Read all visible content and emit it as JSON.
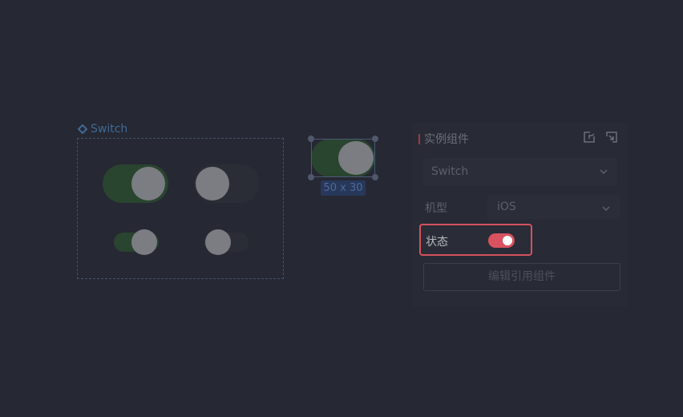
{
  "canvas": {
    "component_name": "Switch",
    "selection_size": "50 x 30",
    "variants": [
      {
        "size": "large",
        "state": "on"
      },
      {
        "size": "large",
        "state": "off"
      },
      {
        "size": "small",
        "state": "on"
      },
      {
        "size": "small",
        "state": "off"
      }
    ]
  },
  "panel": {
    "title": "实例组件",
    "component_select": {
      "value": "Switch"
    },
    "model": {
      "label": "机型",
      "value": "iOS"
    },
    "state": {
      "label": "状态",
      "on": true
    },
    "edit_button": "编辑引用组件",
    "icons": [
      "share-icon",
      "detach-icon"
    ]
  },
  "colors": {
    "background": "#262833",
    "switch_on": "#29442f",
    "accent": "#d8535f",
    "frame_border": "#3f5470",
    "label_blue": "#3f6a96"
  }
}
